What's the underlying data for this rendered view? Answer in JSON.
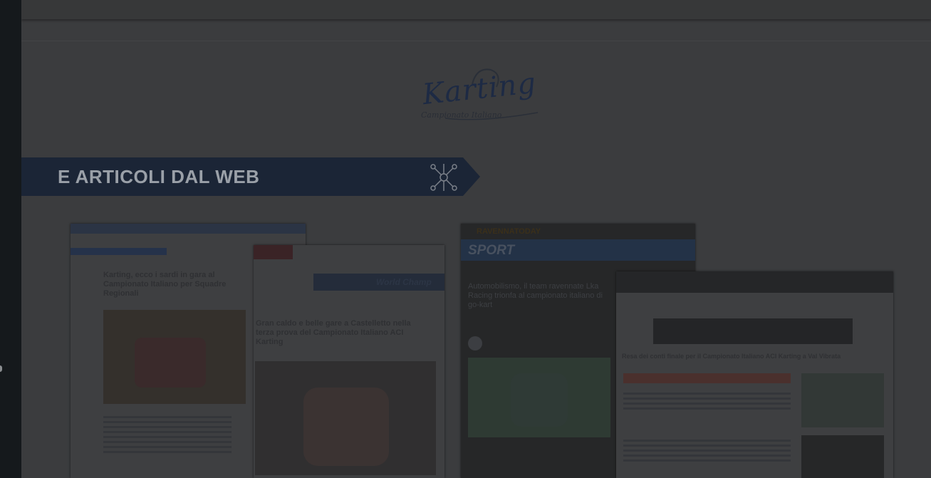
{
  "banner": {
    "title": "E ARTICOLI DAL WEB"
  },
  "logo": {
    "word": "Karting",
    "subtitle": "Campionato Italiano"
  },
  "articles": [
    {
      "headline": "Karting, ecco i sardi in gara al Campionato Italiano per Squadre Regionali"
    },
    {
      "headline": "Gran caldo e belle gare a Castelletto nella terza prova del Campionato Italiano ACI Karting",
      "banner_text": "World Champ"
    },
    {
      "masthead": "RAVENNATODAY",
      "section": "SPORT",
      "headline": "Automobilismo, il team ravennate Lka Racing trionfa al campionato italiano di go-kart"
    },
    {
      "headline": "Resa dei conti finale per il Campionato Italiano ACI Karting a Val Vibrata"
    }
  ],
  "colors": {
    "backdrop": "#1c1e21",
    "banner": "#1b2536",
    "overlay": "rgba(0,0,0,0.75)"
  }
}
